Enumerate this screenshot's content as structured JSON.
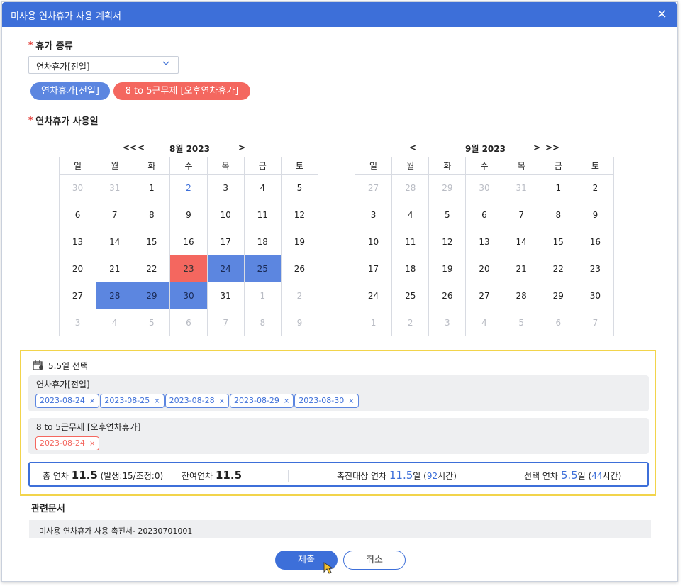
{
  "dialog": {
    "title": "미사용 연차휴가 사용 계획서",
    "close_symbol": "×"
  },
  "leave_type": {
    "required_mark": "*",
    "label": "휴가 종류",
    "select_value": "연차휴가[전일]",
    "chips": [
      "연차휴가[전일]",
      "8 to 5근무제 [오후연차휴가]"
    ]
  },
  "leave_dates": {
    "required_mark": "*",
    "label": "연차휴가 사용일"
  },
  "calendar": {
    "weekdays": [
      "일",
      "월",
      "화",
      "수",
      "목",
      "금",
      "토"
    ],
    "left": {
      "nav_prev_year": "<<",
      "nav_prev": "<",
      "month_label": "8월 2023",
      "nav_next": ">",
      "days": [
        [
          "30",
          "31",
          "1",
          "2",
          "3",
          "4",
          "5"
        ],
        [
          "6",
          "7",
          "8",
          "9",
          "10",
          "11",
          "12"
        ],
        [
          "13",
          "14",
          "15",
          "16",
          "17",
          "18",
          "19"
        ],
        [
          "20",
          "21",
          "22",
          "23",
          "24",
          "25",
          "26"
        ],
        [
          "27",
          "28",
          "29",
          "30",
          "31",
          "1",
          "2"
        ],
        [
          "3",
          "4",
          "5",
          "6",
          "7",
          "8",
          "9"
        ]
      ]
    },
    "right": {
      "nav_prev": "<",
      "month_label": "9월 2023",
      "nav_next": ">",
      "nav_next_year": ">>",
      "days": [
        [
          "27",
          "28",
          "29",
          "30",
          "31",
          "1",
          "2"
        ],
        [
          "3",
          "4",
          "5",
          "6",
          "7",
          "8",
          "9"
        ],
        [
          "10",
          "11",
          "12",
          "13",
          "14",
          "15",
          "16"
        ],
        [
          "17",
          "18",
          "19",
          "20",
          "21",
          "22",
          "23"
        ],
        [
          "24",
          "25",
          "26",
          "27",
          "28",
          "29",
          "30"
        ],
        [
          "1",
          "2",
          "3",
          "4",
          "5",
          "6",
          "7"
        ]
      ]
    }
  },
  "summary": {
    "selected_label": "5.5일 선택",
    "full_day_group": {
      "name": "연차휴가[전일]",
      "dates": [
        "2023-08-24",
        "2023-08-25",
        "2023-08-28",
        "2023-08-29",
        "2023-08-30"
      ]
    },
    "half_day_group": {
      "name": "8 to 5근무제 [오후연차휴가]",
      "dates": [
        "2023-08-24"
      ]
    },
    "remove_symbol": "×",
    "stats": {
      "total_label": "총 연차",
      "total_value": "11.5",
      "total_detail": "(발생:15/조정:0)",
      "remaining_label": "잔여연차",
      "remaining_value": "11.5",
      "target_label": "촉진대상 연차",
      "target_value": "11.5",
      "target_unit": "일 (",
      "target_hours": "92",
      "target_hours_unit": "시간)",
      "selected_label": "선택 연차",
      "selected_value": "5.5",
      "selected_unit": "일 (",
      "selected_hours": "44",
      "selected_hours_unit": "시간)"
    }
  },
  "related": {
    "label": "관련문서",
    "document": "미사용 연차휴가 사용 촉진서- 20230701001"
  },
  "buttons": {
    "submit": "제출",
    "cancel": "취소"
  },
  "colors": {
    "primary": "#3d6fd9",
    "selected_blue": "#5c86e0",
    "selected_red": "#f4675f",
    "highlight_border": "#f2d44b"
  }
}
